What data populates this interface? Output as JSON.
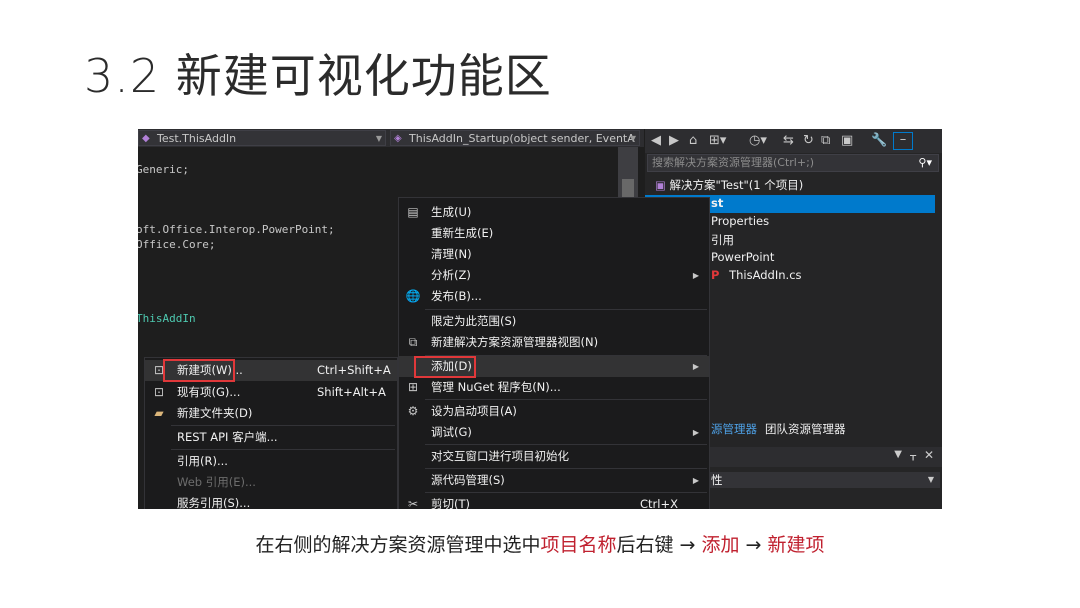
{
  "slide": {
    "title": "3.2 新建可视化功能区",
    "caption": {
      "part1": "在右侧的解决方案资源管理中选中",
      "part2": "项目名称",
      "part3": "后右键 → ",
      "part4": "添加",
      "part5": " → ",
      "part6": "新建项"
    }
  },
  "editor": {
    "class_combo": "Test.ThisAddIn",
    "member_combo": "ThisAddIn_Startup(object sender, EventA",
    "code_lines": [
      "Generic;",
      "oft.Office.Interop.PowerPoint;",
      "Office.Core;",
      "ThisAddIn"
    ]
  },
  "solution_explorer": {
    "search_placeholder": "搜索解决方案资源管理器(Ctrl+;)",
    "solution": "解决方案\"Test\"(1 个项目)",
    "project": "st",
    "properties": "Properties",
    "references": "引用",
    "powerpoint": "PowerPoint",
    "file": "ThisAddIn.cs",
    "tab1": "源管理器",
    "tab2": "团队资源管理器",
    "props_label": "性"
  },
  "context_menu": {
    "items": [
      {
        "label": "生成(U)",
        "icon": "build-icon"
      },
      {
        "label": "重新生成(E)"
      },
      {
        "label": "清理(N)"
      },
      {
        "label": "分析(Z)",
        "submenu": true
      },
      {
        "label": "发布(B)...",
        "icon": "publish-icon"
      },
      {
        "label": "限定为此范围(S)"
      },
      {
        "label": "新建解决方案资源管理器视图(N)",
        "icon": "new-view-icon"
      },
      {
        "label": "添加(D)",
        "submenu": true,
        "highlighted": true
      },
      {
        "label": "管理 NuGet 程序包(N)...",
        "icon": "nuget-icon"
      },
      {
        "label": "设为启动项目(A)",
        "icon": "gear-icon"
      },
      {
        "label": "调试(G)",
        "submenu": true
      },
      {
        "label": "对交互窗口进行项目初始化"
      },
      {
        "label": "源代码管理(S)",
        "submenu": true
      },
      {
        "label": "剪切(T)",
        "shortcut": "Ctrl+X",
        "icon": "cut-icon"
      }
    ]
  },
  "add_submenu": {
    "items": [
      {
        "label": "新建项(W)...",
        "shortcut": "Ctrl+Shift+A",
        "icon": "new-item-icon",
        "highlighted": true
      },
      {
        "label": "现有项(G)...",
        "shortcut": "Shift+Alt+A",
        "icon": "existing-item-icon"
      },
      {
        "label": "新建文件夹(D)",
        "icon": "folder-icon"
      },
      {
        "label": "REST API 客户端..."
      },
      {
        "label": "引用(R)..."
      },
      {
        "label": "Web 引用(E)...",
        "disabled": true
      },
      {
        "label": "服务引用(S)..."
      }
    ]
  },
  "colors": {
    "accent": "#007acc",
    "highlight_border": "#e0383a",
    "caption_red": "#c0212f"
  }
}
